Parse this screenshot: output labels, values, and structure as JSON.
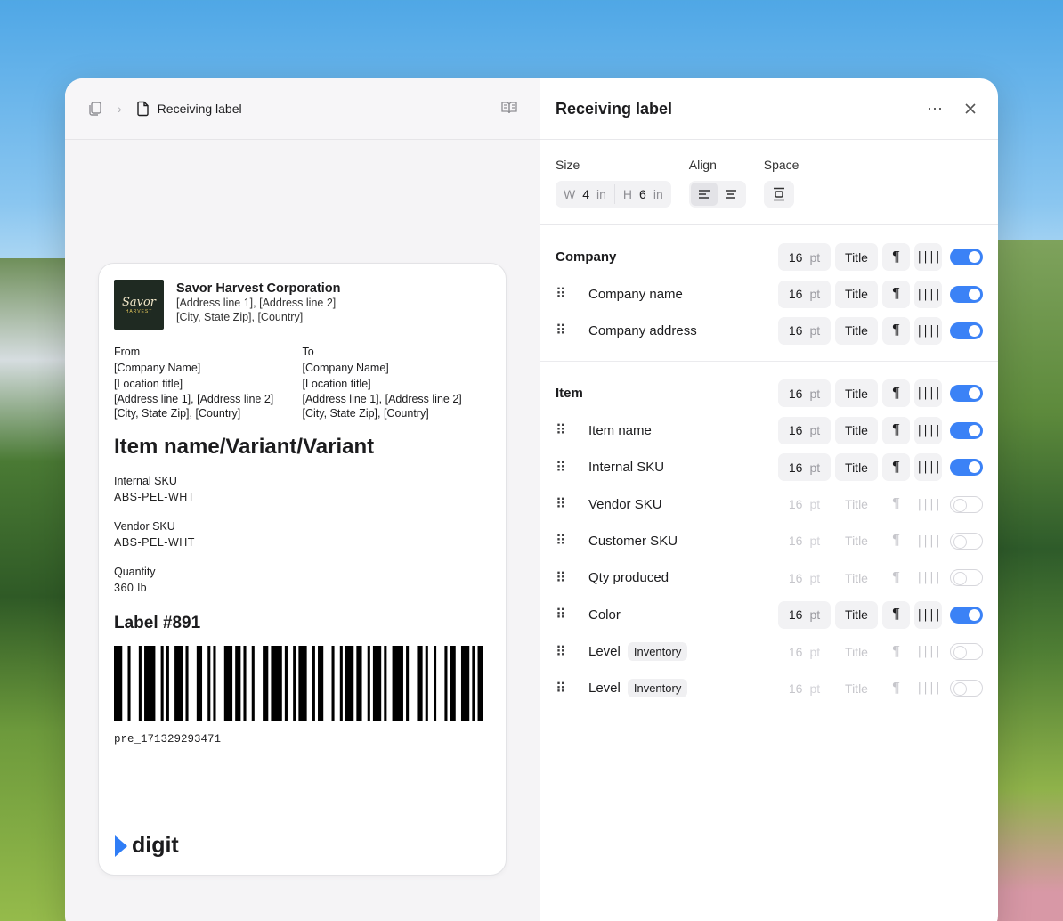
{
  "breadcrumb": {
    "title": "Receiving label"
  },
  "label": {
    "company_name": "Savor Harvest Corporation",
    "company_line1": "[Address line 1], [Address line 2]",
    "company_line2": "[City, State Zip], [Country]",
    "logo_text": "Savor",
    "logo_sub": "HARVEST",
    "from_heading": "From",
    "to_heading": "To",
    "from_company": "[Company Name]",
    "from_location": "[Location title]",
    "from_addr1": "[Address line 1], [Address line 2]",
    "from_addr2": "[City, State Zip], [Country]",
    "to_company": "[Company Name]",
    "to_location": "[Location title]",
    "to_addr1": "[Address line 1], [Address line 2]",
    "to_addr2": "[City, State Zip], [Country]",
    "item_title": "Item name/Variant/Variant",
    "fields": [
      {
        "label": "Internal SKU",
        "value": "ABS-PEL-WHT"
      },
      {
        "label": "Vendor SKU",
        "value": "ABS-PEL-WHT"
      },
      {
        "label": "Quantity",
        "value": "360 lb"
      }
    ],
    "label_number": "Label #891",
    "barcode_value": "pre_171329293471",
    "brand": "digit"
  },
  "panel": {
    "title": "Receiving label",
    "size_label": "Size",
    "align_label": "Align",
    "space_label": "Space",
    "width_prefix": "W",
    "width_value": "4",
    "width_unit": "in",
    "height_prefix": "H",
    "height_value": "6",
    "height_unit": "in"
  },
  "sections": [
    {
      "rows": [
        {
          "name": "Company",
          "head": true,
          "size": "16",
          "unit": "pt",
          "style": "Title",
          "enabled": true
        },
        {
          "name": "Company name",
          "size": "16",
          "unit": "pt",
          "style": "Title",
          "enabled": true
        },
        {
          "name": "Company address",
          "size": "16",
          "unit": "pt",
          "style": "Title",
          "enabled": true
        }
      ]
    },
    {
      "rows": [
        {
          "name": "Item",
          "head": true,
          "size": "16",
          "unit": "pt",
          "style": "Title",
          "enabled": true
        },
        {
          "name": "Item name",
          "size": "16",
          "unit": "pt",
          "style": "Title",
          "enabled": true
        },
        {
          "name": "Internal SKU",
          "size": "16",
          "unit": "pt",
          "style": "Title",
          "enabled": true
        },
        {
          "name": "Vendor SKU",
          "size": "16",
          "unit": "pt",
          "style": "Title",
          "enabled": false
        },
        {
          "name": "Customer SKU",
          "size": "16",
          "unit": "pt",
          "style": "Title",
          "enabled": false
        },
        {
          "name": "Qty produced",
          "size": "16",
          "unit": "pt",
          "style": "Title",
          "enabled": false
        },
        {
          "name": "Color",
          "size": "16",
          "unit": "pt",
          "style": "Title",
          "enabled": true
        },
        {
          "name": "Level",
          "tag": "Inventory",
          "size": "16",
          "unit": "pt",
          "style": "Title",
          "enabled": false
        },
        {
          "name": "Level",
          "tag": "Inventory",
          "size": "16",
          "unit": "pt",
          "style": "Title",
          "enabled": false
        }
      ]
    }
  ],
  "barcode_pattern": [
    3,
    2,
    1,
    3,
    1,
    1,
    4,
    2,
    1,
    1,
    1,
    2,
    3,
    1,
    1,
    3,
    2,
    2,
    1,
    1,
    1,
    3,
    3,
    1,
    2,
    1,
    1,
    2,
    1,
    3,
    2,
    1,
    4,
    1,
    1,
    2,
    1,
    1,
    3,
    2,
    1,
    1,
    2,
    3,
    1,
    2,
    1,
    1,
    3,
    1,
    2,
    2,
    1,
    1,
    3,
    1,
    1,
    2,
    4,
    1,
    1,
    3,
    2,
    1,
    1,
    2,
    1,
    3,
    1,
    1,
    2,
    2,
    3,
    1,
    1,
    1,
    2,
    3
  ],
  "colors": {
    "accent": "#3b82f6"
  }
}
